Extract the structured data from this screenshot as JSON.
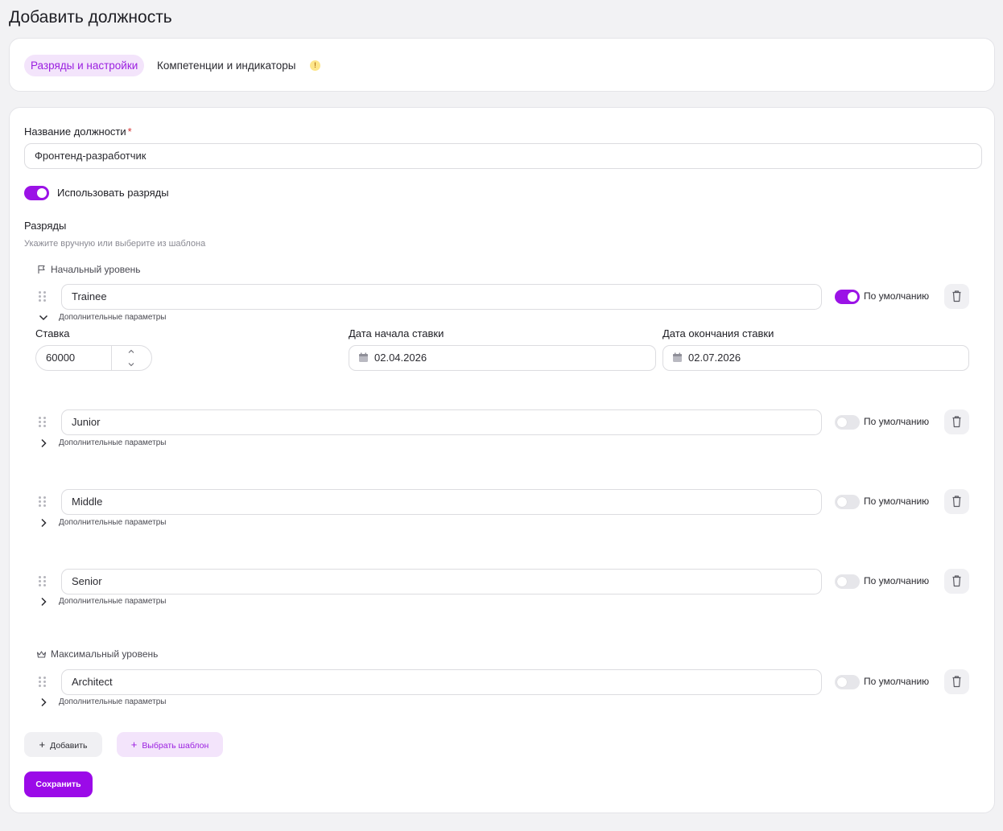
{
  "page": {
    "title": "Добавить должность"
  },
  "tabs": [
    {
      "label": "Разряды и настройки",
      "active": true
    },
    {
      "label": "Компетенции и индикаторы",
      "active": false,
      "badge": "!"
    }
  ],
  "form": {
    "position_name_label": "Название должности",
    "required_mark": "*",
    "position_name_value": "Фронтенд-разработчик",
    "use_grades_label": "Использовать разряды",
    "use_grades_on": true,
    "grades_title": "Разряды",
    "grades_hint": "Укажите вручную или выберите из шаблона",
    "start_level_label": "Начальный уровень",
    "max_level_label": "Максимальный уровень",
    "advanced_label": "Дополнительные параметры",
    "default_label": "По умолчанию",
    "grades": [
      {
        "name": "Trainee",
        "default": true,
        "expanded": true
      },
      {
        "name": "Junior",
        "default": false,
        "expanded": false
      },
      {
        "name": "Middle",
        "default": false,
        "expanded": false
      },
      {
        "name": "Senior",
        "default": false,
        "expanded": false
      },
      {
        "name": "Architect",
        "default": false,
        "expanded": false
      }
    ],
    "rate_label": "Ставка",
    "rate_value": "60000",
    "rate_start_label": "Дата начала ставки",
    "rate_start_value": "02.04.2026",
    "rate_end_label": "Дата окончания ставки",
    "rate_end_value": "02.07.2026"
  },
  "actions": {
    "add_label": "Добавить",
    "template_label": "Выбрать шаблон",
    "save_label": "Сохранить"
  },
  "colors": {
    "accent": "#9b12e6",
    "accent_light": "#f3e4fb"
  }
}
